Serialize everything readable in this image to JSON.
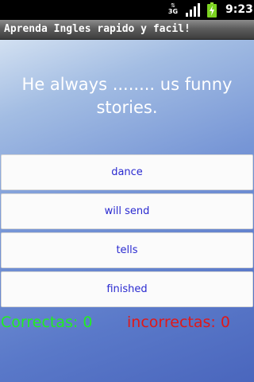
{
  "status_bar": {
    "network_type": "3G",
    "network_arrows": "⇅",
    "time": "9:23",
    "icons": [
      "data-3g-icon",
      "signal-bars-icon",
      "battery-charging-icon"
    ]
  },
  "app": {
    "title": "Aprenda Ingles rapido y facil!"
  },
  "quiz": {
    "question": "He always ........ us funny stories.",
    "answers": [
      {
        "label": "dance"
      },
      {
        "label": "will send"
      },
      {
        "label": "tells"
      },
      {
        "label": "finished"
      }
    ]
  },
  "score": {
    "correct_text": "Correctas: 0",
    "incorrect_text": "incorrectas: 0"
  },
  "colors": {
    "answer_text": "#2a2ad0",
    "correct": "#22ee22",
    "incorrect": "#e01818",
    "background_top": "#d2e0f1",
    "background_bottom": "#4a66bd"
  }
}
